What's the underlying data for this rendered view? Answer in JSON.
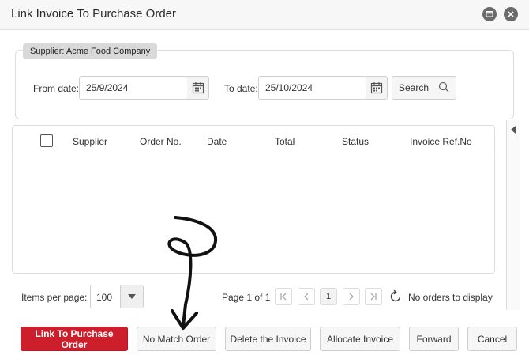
{
  "window": {
    "title": "Link Invoice To Purchase Order"
  },
  "filter": {
    "supplier_tag": "Supplier: Acme Food Company",
    "from_label": "From date:",
    "from_value": "25/9/2024",
    "to_label": "To date:",
    "to_value": "25/10/2024",
    "search_label": "Search"
  },
  "grid": {
    "columns": [
      "Supplier",
      "Order No.",
      "Date",
      "Total",
      "Status",
      "Invoice Ref.No"
    ]
  },
  "pager": {
    "items_per_page_label": "Items per page:",
    "page_size": "100",
    "page_info": "Page 1 of 1",
    "current_page": "1",
    "status_text": "No orders to display"
  },
  "actions": {
    "link": "Link To Purchase Order",
    "no_match": "No Match Order",
    "delete": "Delete the Invoice",
    "allocate": "Allocate Invoice",
    "forward": "Forward",
    "cancel": "Cancel"
  },
  "colors": {
    "primary": "#cc1f2b",
    "annotation": "#111111"
  }
}
